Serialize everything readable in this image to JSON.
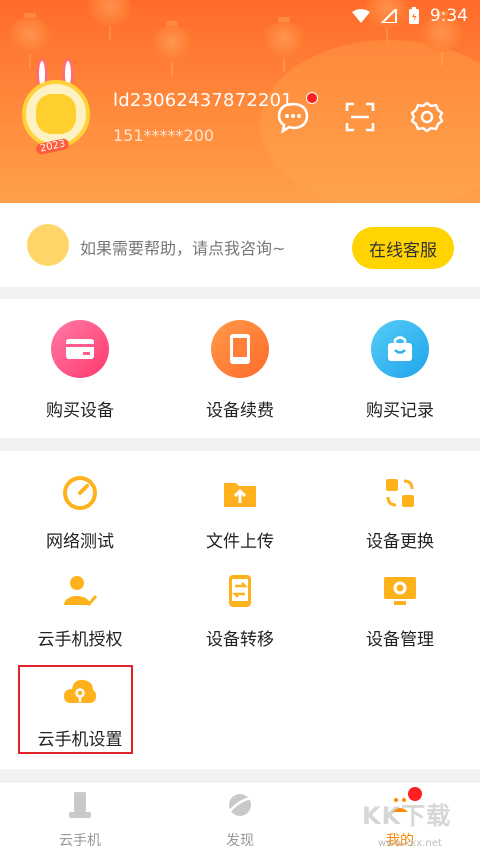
{
  "status_bar": {
    "time": "9:34"
  },
  "profile": {
    "username": "ld23062437872201",
    "phone": "151*****200",
    "avatar_badge": "2023"
  },
  "help": {
    "text": "如果需要帮助，请点我咨询~",
    "button": "在线客服"
  },
  "primary_actions": [
    {
      "label": "购买设备",
      "icon": "card-icon",
      "color": "#ff4f86"
    },
    {
      "label": "设备续费",
      "icon": "phone-icon",
      "color": "#ff7a3c"
    },
    {
      "label": "购买记录",
      "icon": "bag-icon",
      "color": "#2fb6f0"
    }
  ],
  "tools": [
    {
      "label": "网络测试",
      "icon": "speedometer-icon"
    },
    {
      "label": "文件上传",
      "icon": "upload-folder-icon"
    },
    {
      "label": "设备更换",
      "icon": "swap-icon"
    },
    {
      "label": "云手机授权",
      "icon": "user-check-icon"
    },
    {
      "label": "设备转移",
      "icon": "transfer-icon"
    },
    {
      "label": "设备管理",
      "icon": "monitor-gear-icon"
    },
    {
      "label": "云手机设置",
      "icon": "cloud-key-icon"
    }
  ],
  "tabs": [
    {
      "label": "云手机",
      "icon": "phone-stand-icon"
    },
    {
      "label": "发现",
      "icon": "planet-icon"
    },
    {
      "label": "我的",
      "icon": "profile-icon"
    }
  ],
  "watermark": {
    "text": "KK下载",
    "url": "www.kkx.net"
  },
  "colors": {
    "accent": "#ffd400",
    "header": "#ff7a33",
    "icon_orange": "#ffb21e",
    "highlight_box": "#e0242a"
  }
}
